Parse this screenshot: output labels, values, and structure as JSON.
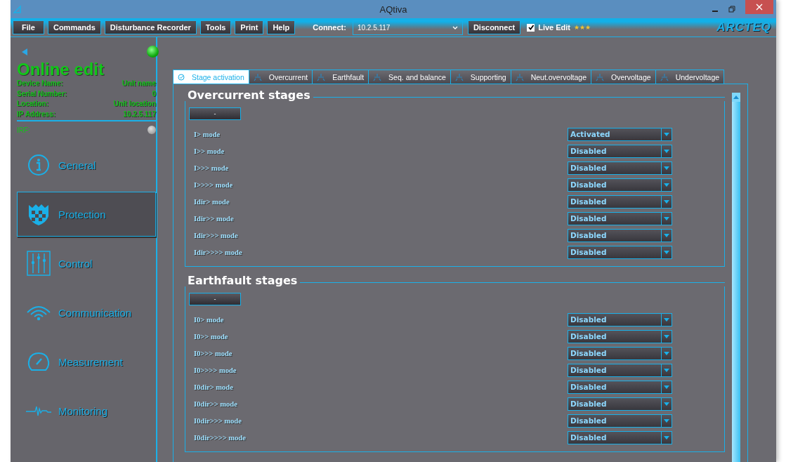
{
  "window": {
    "title": "AQtiva"
  },
  "menu": [
    "File",
    "Commands",
    "Disturbance Recorder",
    "Tools",
    "Print",
    "Help"
  ],
  "connect": {
    "label": "Connect:",
    "value": "10.2.5.117"
  },
  "disconnect": "Disconnect",
  "live_edit": {
    "label": "Live Edit",
    "checked": true,
    "stars": "★★★"
  },
  "logo": "ARCTEQ",
  "sidebar": {
    "online": true,
    "title": "Online edit",
    "info": [
      {
        "label": "Device Name:",
        "value": "Unit name"
      },
      {
        "label": "Serial Number:",
        "value": "0"
      },
      {
        "label": "Location:",
        "value": "Unit location"
      },
      {
        "label": "IP Address:",
        "value": "10.2.5.117"
      }
    ],
    "irf": {
      "label": "IRF:",
      "active": false
    },
    "items": [
      {
        "label": "General",
        "kind": "info",
        "selected": false
      },
      {
        "label": "Protection",
        "kind": "shield",
        "selected": true
      },
      {
        "label": "Control",
        "kind": "sliders",
        "selected": false
      },
      {
        "label": "Communication",
        "kind": "wireless",
        "selected": false
      },
      {
        "label": "Measurement",
        "kind": "gauge",
        "selected": false
      },
      {
        "label": "Monitoring",
        "kind": "pulse",
        "selected": false
      }
    ]
  },
  "tabs": [
    {
      "label": "Stage activation",
      "selected": true
    },
    {
      "label": "Overcurrent",
      "selected": false
    },
    {
      "label": "Earthfault",
      "selected": false
    },
    {
      "label": "Seq. and balance",
      "selected": false
    },
    {
      "label": "Supporting",
      "selected": false
    },
    {
      "label": "Neut.overvoltage",
      "selected": false
    },
    {
      "label": "Overvoltage",
      "selected": false
    },
    {
      "label": "Undervoltage",
      "selected": false
    }
  ],
  "sections": [
    {
      "title": "Overcurrent stages",
      "button": "-",
      "rows": [
        {
          "label": "I> mode",
          "value": "Activated"
        },
        {
          "label": "I>> mode",
          "value": "Disabled"
        },
        {
          "label": "I>>> mode",
          "value": "Disabled"
        },
        {
          "label": "I>>>> mode",
          "value": "Disabled"
        },
        {
          "label": "Idir> mode",
          "value": "Disabled"
        },
        {
          "label": "Idir>> mode",
          "value": "Disabled"
        },
        {
          "label": "Idir>>> mode",
          "value": "Disabled"
        },
        {
          "label": "Idir>>>> mode",
          "value": "Disabled"
        }
      ]
    },
    {
      "title": "Earthfault stages",
      "button": "-",
      "rows": [
        {
          "label": "I0> mode",
          "value": "Disabled"
        },
        {
          "label": "I0>> mode",
          "value": "Disabled"
        },
        {
          "label": "I0>>> mode",
          "value": "Disabled"
        },
        {
          "label": "I0>>>> mode",
          "value": "Disabled"
        },
        {
          "label": "I0dir> mode",
          "value": "Disabled"
        },
        {
          "label": "I0dir>> mode",
          "value": "Disabled"
        },
        {
          "label": "I0dir>>> mode",
          "value": "Disabled"
        },
        {
          "label": "I0dir>>>> mode",
          "value": "Disabled"
        }
      ]
    }
  ]
}
